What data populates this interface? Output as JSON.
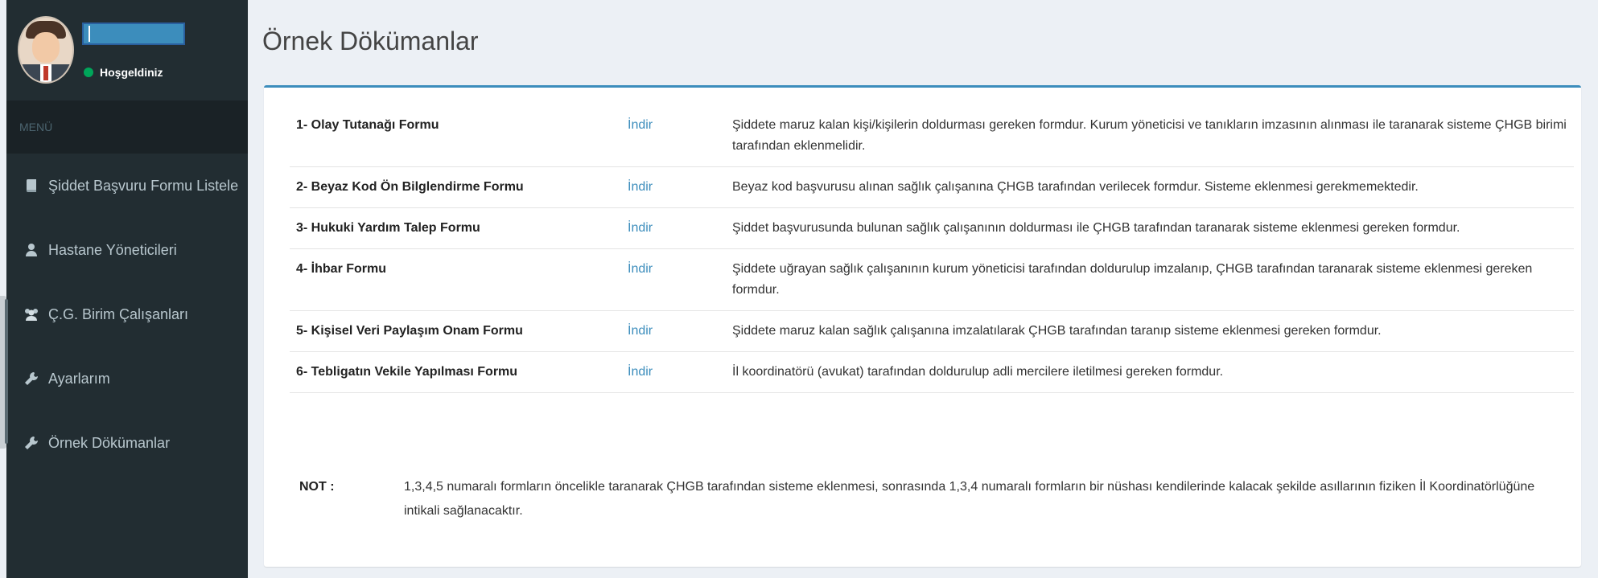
{
  "user": {
    "status_text": "Hoşgeldiniz"
  },
  "sidebar": {
    "menu_header": "MENÜ",
    "items": [
      {
        "label": "Şiddet Başvuru Formu Listele",
        "icon": "book-icon"
      },
      {
        "label": "Hastane Yöneticileri",
        "icon": "user-icon"
      },
      {
        "label": "Ç.G. Birim Çalışanları",
        "icon": "users-icon"
      },
      {
        "label": "Ayarlarım",
        "icon": "wrench-icon"
      },
      {
        "label": "Örnek Dökümanlar",
        "icon": "wrench-icon"
      }
    ]
  },
  "page": {
    "title": "Örnek Dökümanlar"
  },
  "documents": [
    {
      "name": "1- Olay Tutanağı Formu",
      "link": "İndir",
      "desc": "Şiddete maruz kalan kişi/kişilerin doldurması gereken formdur. Kurum yöneticisi ve tanıkların imzasının alınması ile taranarak sisteme ÇHGB birimi tarafından eklenmelidir."
    },
    {
      "name": "2- Beyaz Kod Ön Bilglendirme Formu",
      "link": "İndir",
      "desc": "Beyaz kod başvurusu alınan sağlık çalışanına ÇHGB tarafından verilecek formdur. Sisteme eklenmesi gerekmemektedir."
    },
    {
      "name": "3- Hukuki Yardım Talep Formu",
      "link": "İndir",
      "desc": "Şiddet başvurusunda bulunan sağlık çalışanının doldurması ile ÇHGB tarafından taranarak sisteme eklenmesi gereken formdur."
    },
    {
      "name": "4- İhbar Formu",
      "link": "İndir",
      "desc": "Şiddete uğrayan sağlık çalışanının kurum yöneticisi tarafından doldurulup imzalanıp, ÇHGB tarafından taranarak sisteme eklenmesi gereken formdur."
    },
    {
      "name": "5- Kişisel Veri Paylaşım Onam Formu",
      "link": "İndir",
      "desc": "Şiddete maruz kalan sağlık çalışanına imzalatılarak ÇHGB tarafından taranıp sisteme eklenmesi gereken formdur."
    },
    {
      "name": "6- Tebligatın Vekile Yapılması Formu",
      "link": "İndir",
      "desc": "İl koordinatörü (avukat) tarafından doldurulup adli mercilere iletilmesi gereken formdur."
    }
  ],
  "note": {
    "label": "NOT :",
    "text": "1,3,4,5 numaralı formların öncelikle taranarak ÇHGB tarafından sisteme eklenmesi, sonrasında 1,3,4 numaralı formların bir nüshası kendilerinde kalacak şekilde asıllarının fiziken İl Koordinatörlüğüne intikali sağlanacaktır."
  }
}
